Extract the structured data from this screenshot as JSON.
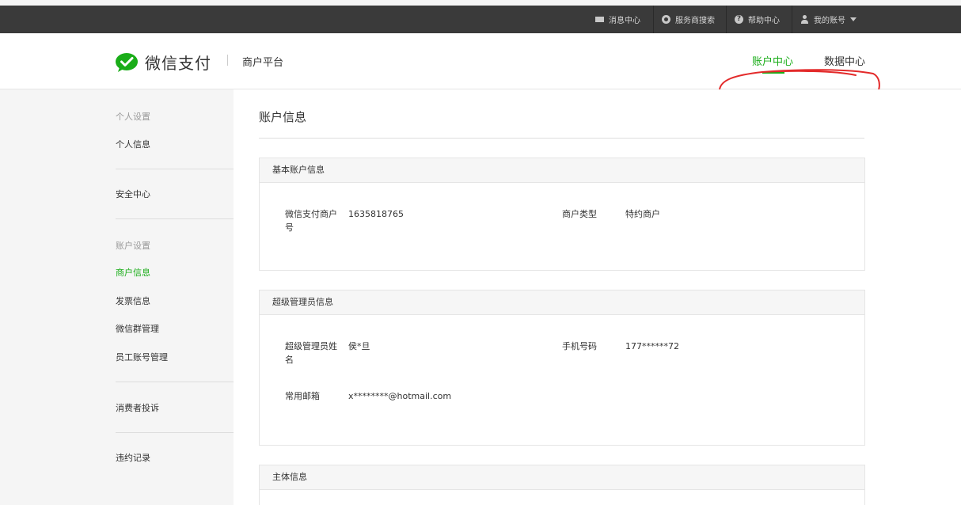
{
  "topbar": {
    "messages": "消息中心",
    "provider_search": "服务商搜索",
    "help": "帮助中心",
    "account": "我的账号"
  },
  "header": {
    "brand": "微信支付",
    "platform": "商户平台",
    "nav": [
      "账户中心",
      "数据中心"
    ],
    "accent_color": "#1aad19",
    "annotation_color": "#e32a2a"
  },
  "sidebar": {
    "groups": [
      {
        "title": "个人设置",
        "items": [
          "个人信息"
        ]
      },
      {
        "title": "",
        "items": [
          "安全中心"
        ]
      },
      {
        "title": "账户设置",
        "items": [
          "商户信息",
          "发票信息",
          "微信群管理",
          "员工账号管理"
        ]
      },
      {
        "title": "",
        "items": [
          "消费者投诉"
        ]
      },
      {
        "title": "",
        "items": [
          "违约记录"
        ]
      }
    ],
    "active_item": "商户信息"
  },
  "main": {
    "title": "账户信息",
    "cards": [
      {
        "heading": "基本账户信息",
        "fields": [
          {
            "label": "微信支付商户号",
            "value": "1635818765"
          },
          {
            "label": "商户类型",
            "value": "特约商户"
          }
        ]
      },
      {
        "heading": "超级管理员信息",
        "fields": [
          {
            "label": "超级管理员姓名",
            "value": "侯*旦"
          },
          {
            "label": "手机号码",
            "value": "177******72"
          },
          {
            "label": "常用邮箱",
            "value": "x********@hotmail.com"
          }
        ]
      },
      {
        "heading": "主体信息",
        "fields": []
      }
    ]
  }
}
